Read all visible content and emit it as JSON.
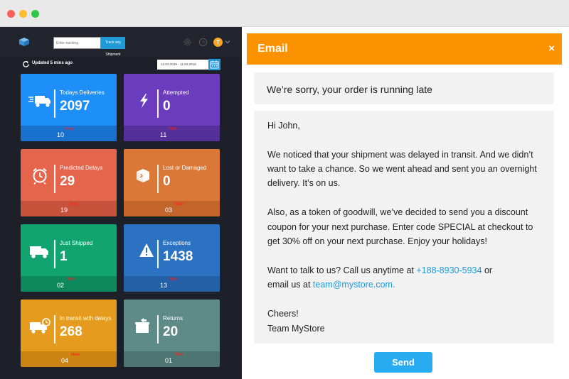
{
  "dashboard": {
    "search": {
      "placeholder": "Enter tracking"
    },
    "track_label": "Track any Shipment",
    "avatar_initial": "T",
    "updated_text": "Updated 5 mins ago",
    "date_range": "12.03.2019 - 11.04.2019",
    "tiles": [
      {
        "label": "Todays Deliveries",
        "value": "2097",
        "count": "10",
        "new": "New",
        "color": "#1e8ff8",
        "foot": "#1872cd",
        "icon": "delivery-truck-icon"
      },
      {
        "label": "Attempted",
        "value": "0",
        "count": "11",
        "new": "New",
        "color": "#6b3cbd",
        "foot": "#55309a",
        "icon": "lightning-icon"
      },
      {
        "label": "Predicted Delays",
        "value": "29",
        "count": "19",
        "new": "New",
        "color": "#e4644c",
        "foot": "#c7523c",
        "icon": "alarm-clock-icon"
      },
      {
        "label": "Lost or Damaged",
        "value": "0",
        "count": "03",
        "new": "New",
        "color": "#db7838",
        "foot": "#c3642a",
        "icon": "damaged-box-icon"
      },
      {
        "label": "Just Shipped",
        "value": "1",
        "count": "02",
        "new": "New",
        "color": "#11a46f",
        "foot": "#0d8a5d",
        "icon": "truck-icon"
      },
      {
        "label": "Exceptions",
        "value": "1438",
        "count": "13",
        "new": "New",
        "color": "#2b72c2",
        "foot": "#2460a5",
        "icon": "warning-icon"
      },
      {
        "label": "In transit with delays",
        "value": "268",
        "count": "04",
        "new": "New",
        "color": "#e59b1d",
        "foot": "#cc8412",
        "icon": "delayed-truck-icon"
      },
      {
        "label": "Returns",
        "value": "20",
        "count": "01",
        "new": "New",
        "color": "#5e8a87",
        "foot": "#4e7572",
        "icon": "return-box-icon"
      }
    ]
  },
  "email": {
    "title": "Email",
    "close": "×",
    "subject": "We’re sorry, your order is running late",
    "greeting": "Hi John,",
    "p1_l1": "We noticed that your shipment was delayed in transit. And we didn’t",
    "p1_l2": "want to take a chance. So we went ahead and sent you an overnight",
    "p1_l3": "delivery. It’s on us.",
    "p2_l1": "Also, as a token of goodwill, we’ve decided to send you a discount",
    "p2_l2": "coupon for your next purchase. Enter code SPECIAL at checkout to",
    "p2_l3": "get 30% off on your next purchase. Enjoy your holidays!",
    "p3_prefix": "Want to talk to us? Call us anytime at ",
    "phone": "+188-8930-5934",
    "p3_suffix": " or",
    "p4_prefix": "email us at ",
    "email_link": "team@mystore.com.",
    "closing": "Cheers!",
    "signature": "Team MyStore",
    "send_label": "Send"
  }
}
